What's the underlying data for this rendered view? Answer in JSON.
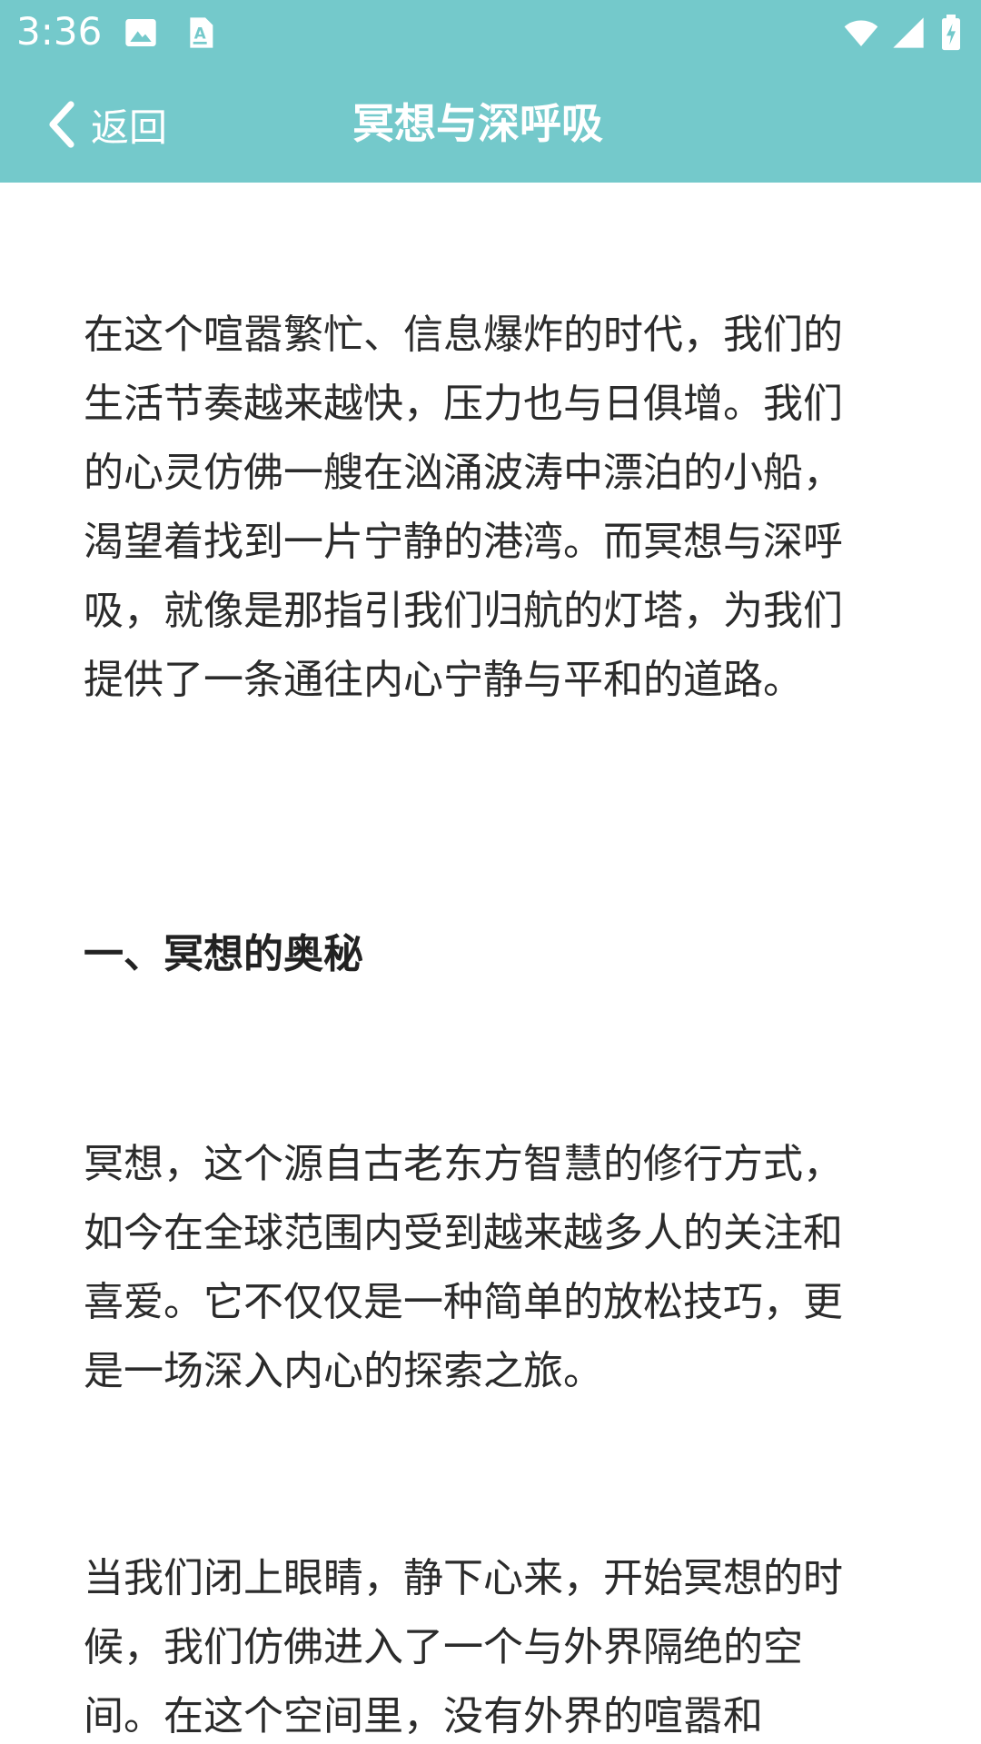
{
  "status_bar": {
    "time": "3:36",
    "left_icons": [
      "image-icon",
      "text-a-icon"
    ],
    "right_icons": [
      "wifi-icon",
      "signal-icon",
      "battery-charging-icon"
    ]
  },
  "app_bar": {
    "back_label": "返回",
    "title": "冥想与深呼吸"
  },
  "article": {
    "paragraph_1": "在这个喧嚣繁忙、信息爆炸的时代，我们的生活节奏越来越快，压力也与日俱增。我们的心灵仿佛一艘在汹涌波涛中漂泊的小船，渴望着找到一片宁静的港湾。而冥想与深呼吸，就像是那指引我们归航的灯塔，为我们提供了一条通往内心宁静与平和的道路。",
    "heading_1": "一、冥想的奥秘",
    "paragraph_2": "冥想，这个源自古老东方智慧的修行方式，如今在全球范围内受到越来越多人的关注和喜爱。它不仅仅是一种简单的放松技巧，更是一场深入内心的探索之旅。",
    "paragraph_3": "当我们闭上眼睛，静下心来，开始冥想的时候，我们仿佛进入了一个与外界隔绝的空间。在这个空间里，没有外界的喧嚣和"
  },
  "colors": {
    "app_bar": "#74C9CB",
    "text": "#2b2b2b",
    "background": "#ffffff"
  }
}
